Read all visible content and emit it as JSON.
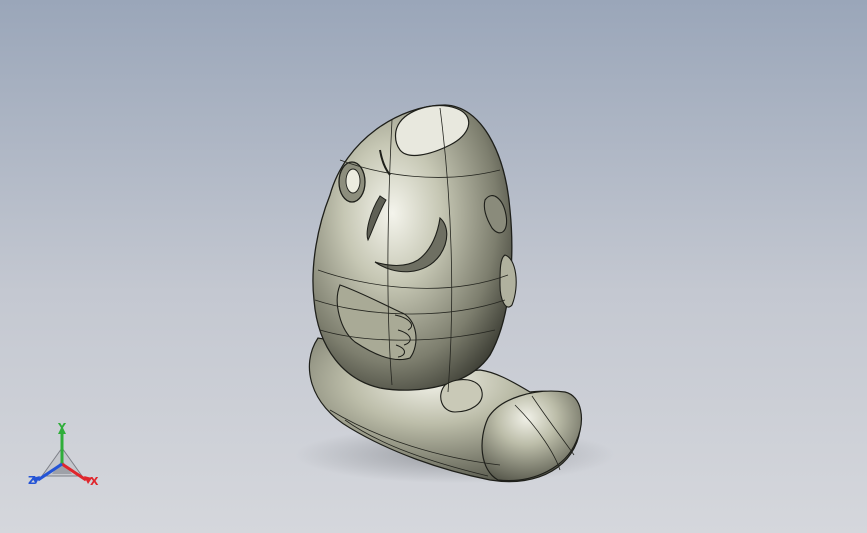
{
  "viewport": {
    "background_top": "#9aa6b9",
    "background_bottom": "#d5d7dc",
    "model_name": "",
    "model_color": "#b6b7a3"
  },
  "triad": {
    "x_label": "X",
    "y_label": "Y",
    "z_label": "Z",
    "x_color": "#e0262c",
    "y_color": "#2fae3a",
    "z_color": "#2454d6"
  }
}
